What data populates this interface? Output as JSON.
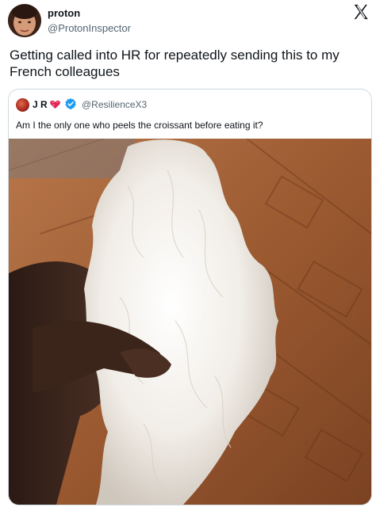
{
  "tweet": {
    "display_name": "proton",
    "handle": "@ProtonInspector",
    "text": "Getting called into HR for repeatedly sending this to my French colleagues",
    "platform_icon": "x-logo-icon"
  },
  "quote": {
    "display_name": "J R",
    "badges": [
      "heart-icon",
      "verified-badge-icon"
    ],
    "handle": "@ResilienceX3",
    "text": "Am I the only one who peels the croissant before eating it?",
    "image": "photo of a hand holding a peeled croissant over a parquet floor"
  },
  "colors": {
    "verified_blue": "#1d9bf0",
    "handle_gray": "#536471",
    "text_dark": "#0f1419",
    "border": "#cfd9de"
  }
}
